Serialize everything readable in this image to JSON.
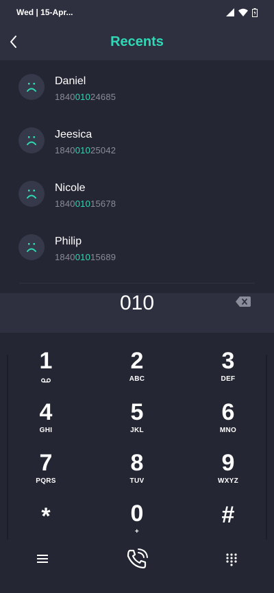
{
  "status_bar": {
    "time": "Wed | 15-Apr..."
  },
  "header": {
    "title": "Recents"
  },
  "recents": [
    {
      "name": "Daniel",
      "number_prefix": "1840",
      "number_match": "010",
      "number_suffix": "24685"
    },
    {
      "name": "Jeesica",
      "number_prefix": "1840",
      "number_match": "010",
      "number_suffix": "25042"
    },
    {
      "name": "Nicole",
      "number_prefix": "1840",
      "number_match": "010",
      "number_suffix": "15678"
    },
    {
      "name": "Philip",
      "number_prefix": "1840",
      "number_match": "010",
      "number_suffix": "15689"
    }
  ],
  "display": {
    "number": "010"
  },
  "keypad": [
    {
      "digit": "1",
      "letters": ""
    },
    {
      "digit": "2",
      "letters": "ABC"
    },
    {
      "digit": "3",
      "letters": "DEF"
    },
    {
      "digit": "4",
      "letters": "GHI"
    },
    {
      "digit": "5",
      "letters": "JKL"
    },
    {
      "digit": "6",
      "letters": "MNO"
    },
    {
      "digit": "7",
      "letters": "PQRS"
    },
    {
      "digit": "8",
      "letters": "TUV"
    },
    {
      "digit": "9",
      "letters": "WXYZ"
    },
    {
      "digit": "*",
      "letters": ""
    },
    {
      "digit": "0",
      "letters": "+"
    },
    {
      "digit": "#",
      "letters": ""
    }
  ],
  "colors": {
    "accent": "#2ed9b5",
    "background": "#242633",
    "panel": "#2e3040",
    "muted_text": "#8a8d99"
  },
  "icons": {
    "back": "chevron-left-icon",
    "backspace": "backspace-icon",
    "menu": "menu-icon",
    "call": "phone-call-icon",
    "dialpad": "dialpad-icon",
    "avatar": "sad-face-icon"
  }
}
